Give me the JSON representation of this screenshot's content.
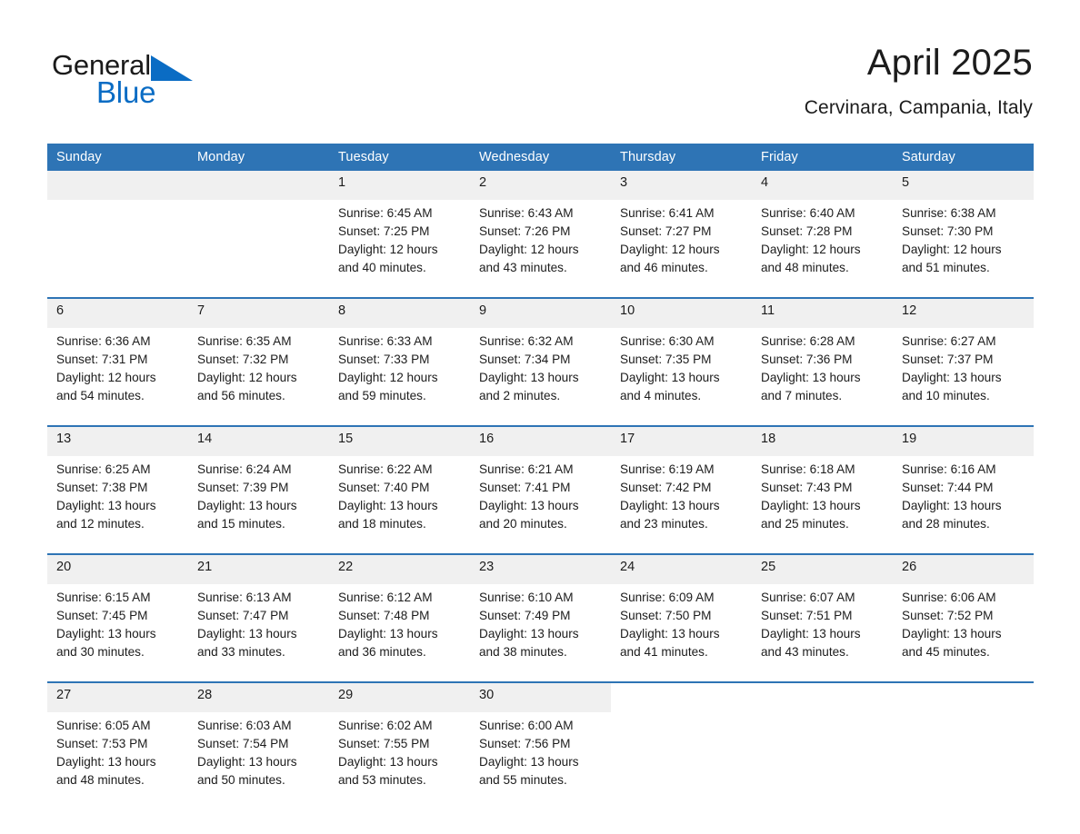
{
  "brand": {
    "word1": "General",
    "word2": "Blue",
    "triangle_color": "#0a6cc4",
    "text_color": "#1a1a1a"
  },
  "header": {
    "title": "April 2025",
    "location": "Cervinara, Campania, Italy"
  },
  "theme": {
    "header_blue": "#2e74b5",
    "daynum_band": "#f0f0f0",
    "body_text": "#1c1c1c"
  },
  "weekday_headers": [
    "Sunday",
    "Monday",
    "Tuesday",
    "Wednesday",
    "Thursday",
    "Friday",
    "Saturday"
  ],
  "weeks": [
    {
      "days": [
        {
          "num": "",
          "sunrise": "",
          "sunset": "",
          "daylight1": "",
          "daylight2": ""
        },
        {
          "num": "",
          "sunrise": "",
          "sunset": "",
          "daylight1": "",
          "daylight2": ""
        },
        {
          "num": "1",
          "sunrise": "Sunrise: 6:45 AM",
          "sunset": "Sunset: 7:25 PM",
          "daylight1": "Daylight: 12 hours",
          "daylight2": "and 40 minutes."
        },
        {
          "num": "2",
          "sunrise": "Sunrise: 6:43 AM",
          "sunset": "Sunset: 7:26 PM",
          "daylight1": "Daylight: 12 hours",
          "daylight2": "and 43 minutes."
        },
        {
          "num": "3",
          "sunrise": "Sunrise: 6:41 AM",
          "sunset": "Sunset: 7:27 PM",
          "daylight1": "Daylight: 12 hours",
          "daylight2": "and 46 minutes."
        },
        {
          "num": "4",
          "sunrise": "Sunrise: 6:40 AM",
          "sunset": "Sunset: 7:28 PM",
          "daylight1": "Daylight: 12 hours",
          "daylight2": "and 48 minutes."
        },
        {
          "num": "5",
          "sunrise": "Sunrise: 6:38 AM",
          "sunset": "Sunset: 7:30 PM",
          "daylight1": "Daylight: 12 hours",
          "daylight2": "and 51 minutes."
        }
      ]
    },
    {
      "days": [
        {
          "num": "6",
          "sunrise": "Sunrise: 6:36 AM",
          "sunset": "Sunset: 7:31 PM",
          "daylight1": "Daylight: 12 hours",
          "daylight2": "and 54 minutes."
        },
        {
          "num": "7",
          "sunrise": "Sunrise: 6:35 AM",
          "sunset": "Sunset: 7:32 PM",
          "daylight1": "Daylight: 12 hours",
          "daylight2": "and 56 minutes."
        },
        {
          "num": "8",
          "sunrise": "Sunrise: 6:33 AM",
          "sunset": "Sunset: 7:33 PM",
          "daylight1": "Daylight: 12 hours",
          "daylight2": "and 59 minutes."
        },
        {
          "num": "9",
          "sunrise": "Sunrise: 6:32 AM",
          "sunset": "Sunset: 7:34 PM",
          "daylight1": "Daylight: 13 hours",
          "daylight2": "and 2 minutes."
        },
        {
          "num": "10",
          "sunrise": "Sunrise: 6:30 AM",
          "sunset": "Sunset: 7:35 PM",
          "daylight1": "Daylight: 13 hours",
          "daylight2": "and 4 minutes."
        },
        {
          "num": "11",
          "sunrise": "Sunrise: 6:28 AM",
          "sunset": "Sunset: 7:36 PM",
          "daylight1": "Daylight: 13 hours",
          "daylight2": "and 7 minutes."
        },
        {
          "num": "12",
          "sunrise": "Sunrise: 6:27 AM",
          "sunset": "Sunset: 7:37 PM",
          "daylight1": "Daylight: 13 hours",
          "daylight2": "and 10 minutes."
        }
      ]
    },
    {
      "days": [
        {
          "num": "13",
          "sunrise": "Sunrise: 6:25 AM",
          "sunset": "Sunset: 7:38 PM",
          "daylight1": "Daylight: 13 hours",
          "daylight2": "and 12 minutes."
        },
        {
          "num": "14",
          "sunrise": "Sunrise: 6:24 AM",
          "sunset": "Sunset: 7:39 PM",
          "daylight1": "Daylight: 13 hours",
          "daylight2": "and 15 minutes."
        },
        {
          "num": "15",
          "sunrise": "Sunrise: 6:22 AM",
          "sunset": "Sunset: 7:40 PM",
          "daylight1": "Daylight: 13 hours",
          "daylight2": "and 18 minutes."
        },
        {
          "num": "16",
          "sunrise": "Sunrise: 6:21 AM",
          "sunset": "Sunset: 7:41 PM",
          "daylight1": "Daylight: 13 hours",
          "daylight2": "and 20 minutes."
        },
        {
          "num": "17",
          "sunrise": "Sunrise: 6:19 AM",
          "sunset": "Sunset: 7:42 PM",
          "daylight1": "Daylight: 13 hours",
          "daylight2": "and 23 minutes."
        },
        {
          "num": "18",
          "sunrise": "Sunrise: 6:18 AM",
          "sunset": "Sunset: 7:43 PM",
          "daylight1": "Daylight: 13 hours",
          "daylight2": "and 25 minutes."
        },
        {
          "num": "19",
          "sunrise": "Sunrise: 6:16 AM",
          "sunset": "Sunset: 7:44 PM",
          "daylight1": "Daylight: 13 hours",
          "daylight2": "and 28 minutes."
        }
      ]
    },
    {
      "days": [
        {
          "num": "20",
          "sunrise": "Sunrise: 6:15 AM",
          "sunset": "Sunset: 7:45 PM",
          "daylight1": "Daylight: 13 hours",
          "daylight2": "and 30 minutes."
        },
        {
          "num": "21",
          "sunrise": "Sunrise: 6:13 AM",
          "sunset": "Sunset: 7:47 PM",
          "daylight1": "Daylight: 13 hours",
          "daylight2": "and 33 minutes."
        },
        {
          "num": "22",
          "sunrise": "Sunrise: 6:12 AM",
          "sunset": "Sunset: 7:48 PM",
          "daylight1": "Daylight: 13 hours",
          "daylight2": "and 36 minutes."
        },
        {
          "num": "23",
          "sunrise": "Sunrise: 6:10 AM",
          "sunset": "Sunset: 7:49 PM",
          "daylight1": "Daylight: 13 hours",
          "daylight2": "and 38 minutes."
        },
        {
          "num": "24",
          "sunrise": "Sunrise: 6:09 AM",
          "sunset": "Sunset: 7:50 PM",
          "daylight1": "Daylight: 13 hours",
          "daylight2": "and 41 minutes."
        },
        {
          "num": "25",
          "sunrise": "Sunrise: 6:07 AM",
          "sunset": "Sunset: 7:51 PM",
          "daylight1": "Daylight: 13 hours",
          "daylight2": "and 43 minutes."
        },
        {
          "num": "26",
          "sunrise": "Sunrise: 6:06 AM",
          "sunset": "Sunset: 7:52 PM",
          "daylight1": "Daylight: 13 hours",
          "daylight2": "and 45 minutes."
        }
      ]
    },
    {
      "days": [
        {
          "num": "27",
          "sunrise": "Sunrise: 6:05 AM",
          "sunset": "Sunset: 7:53 PM",
          "daylight1": "Daylight: 13 hours",
          "daylight2": "and 48 minutes."
        },
        {
          "num": "28",
          "sunrise": "Sunrise: 6:03 AM",
          "sunset": "Sunset: 7:54 PM",
          "daylight1": "Daylight: 13 hours",
          "daylight2": "and 50 minutes."
        },
        {
          "num": "29",
          "sunrise": "Sunrise: 6:02 AM",
          "sunset": "Sunset: 7:55 PM",
          "daylight1": "Daylight: 13 hours",
          "daylight2": "and 53 minutes."
        },
        {
          "num": "30",
          "sunrise": "Sunrise: 6:00 AM",
          "sunset": "Sunset: 7:56 PM",
          "daylight1": "Daylight: 13 hours",
          "daylight2": "and 55 minutes."
        },
        {
          "num": "",
          "sunrise": "",
          "sunset": "",
          "daylight1": "",
          "daylight2": ""
        },
        {
          "num": "",
          "sunrise": "",
          "sunset": "",
          "daylight1": "",
          "daylight2": ""
        },
        {
          "num": "",
          "sunrise": "",
          "sunset": "",
          "daylight1": "",
          "daylight2": ""
        }
      ]
    }
  ]
}
